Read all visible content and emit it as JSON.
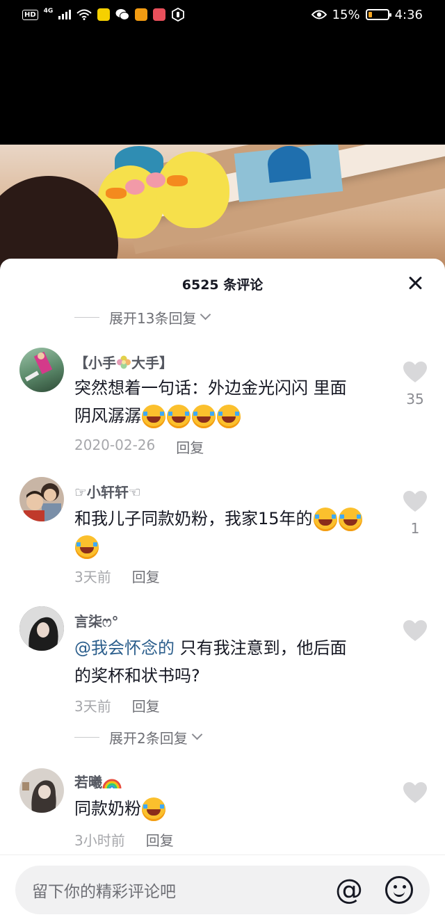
{
  "status_bar": {
    "hd": "HD",
    "network": "4G",
    "battery": "15%",
    "time": "4:36"
  },
  "sheet": {
    "title": "6525 条评论"
  },
  "expand_top": {
    "label": "展开13条回复"
  },
  "expand_mid": {
    "label": "展开2条回复"
  },
  "comments": [
    {
      "name_prefix": "【小手",
      "name_suffix": "大手】",
      "text_line1": "突然想着一句话：外边金光闪闪 里面",
      "text_line2": "阴风潺潺",
      "date": "2020-02-26",
      "reply": "回复",
      "likes": "35"
    },
    {
      "name": "☞小轩轩☜",
      "text_line1": "和我儿子同款奶粉，我家15年的",
      "date": "3天前",
      "reply": "回复",
      "likes": "1"
    },
    {
      "name": "言柒ෆ°",
      "mention": "@我会怀念的",
      "text_line1": " 只有我注意到，他后面",
      "text_line2": "的奖杯和状书吗?",
      "date": "3天前",
      "reply": "回复"
    },
    {
      "name": "若曦",
      "text_line1": "同款奶粉",
      "date": "3小时前",
      "reply": "回复"
    }
  ],
  "input": {
    "placeholder": "留下你的精彩评论吧",
    "at_symbol": "@"
  },
  "colors": {
    "heart": "#d8d8da",
    "mention": "#2b5e8c",
    "sheet_bg": "#ffffff"
  },
  "icons": [
    "close-icon",
    "heart-icon",
    "at-icon",
    "smile-icon",
    "chevron-down-icon"
  ]
}
